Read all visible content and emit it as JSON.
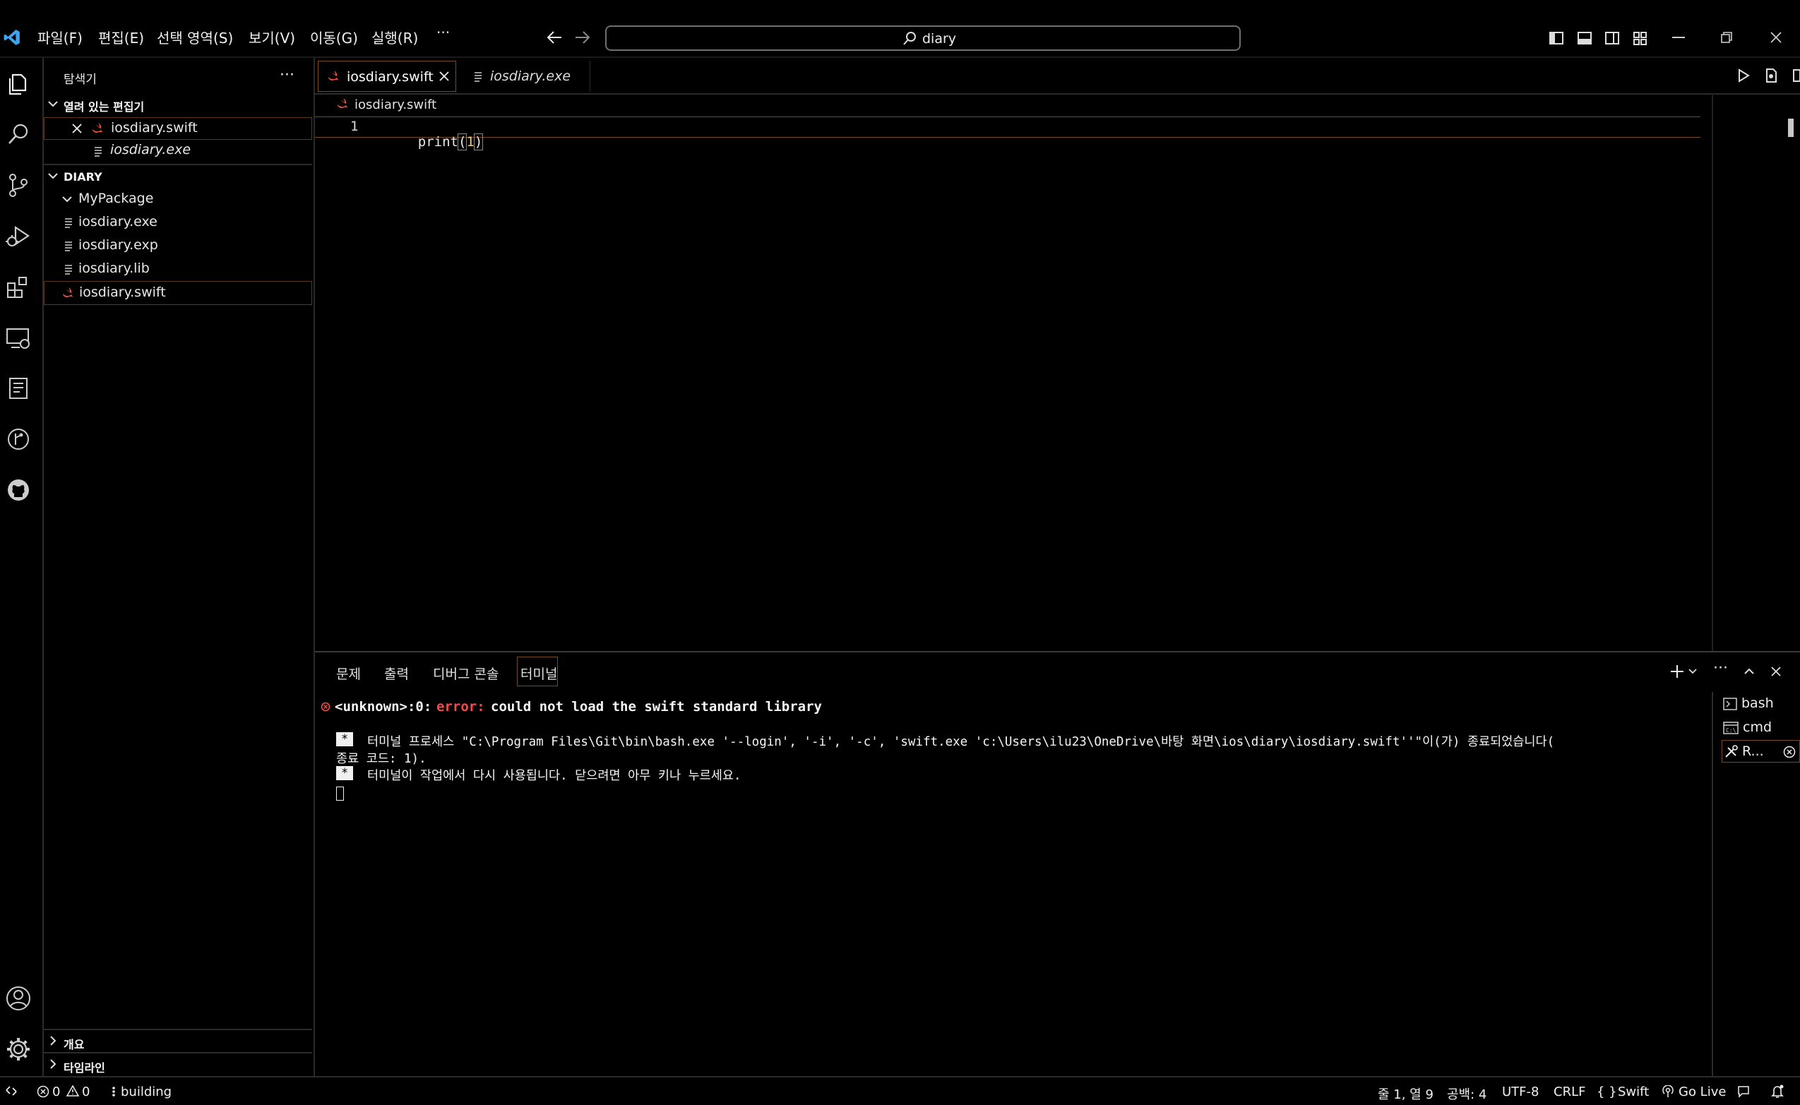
{
  "menu": [
    "파일(F)",
    "편집(E)",
    "선택 영역(S)",
    "보기(V)",
    "이동(G)",
    "실행(R)",
    "···"
  ],
  "search": {
    "text": "diary"
  },
  "sidebar": {
    "title": "탐색기",
    "more": "···",
    "open_editors": {
      "header": "열려 있는 편집기",
      "items": [
        "iosdiary.swift",
        "iosdiary.exe"
      ]
    },
    "folder": {
      "header": "DIARY",
      "items": [
        "MyPackage",
        "iosdiary.exe",
        "iosdiary.exp",
        "iosdiary.lib",
        "iosdiary.swift"
      ]
    },
    "outline": "개요",
    "timeline": "타임라인"
  },
  "tabs": [
    {
      "label": "iosdiary.swift",
      "active": true
    },
    {
      "label": "iosdiary.exe",
      "active": false
    }
  ],
  "breadcrumb": "iosdiary.swift",
  "editor": {
    "line_number": "1",
    "code_fn": "print",
    "code_open": "(",
    "code_arg": "1",
    "code_close": ")"
  },
  "panel": {
    "tabs": [
      "문제",
      "출력",
      "디버그 콘솔",
      "터미널"
    ],
    "terminal": {
      "error_source": "<unknown>:0:",
      "error_word": "error:",
      "error_msg": "could not load the swift standard library",
      "star": "*",
      "line1": "터미널 프로세스 \"C:\\Program Files\\Git\\bin\\bash.exe '--login', '-i', '-c', 'swift.exe 'c:\\Users\\ilu23\\OneDrive\\바탕 화면\\ios\\diary\\iosdiary.swift''\"이(가) 종료되었습니다(",
      "line1b": "종료 코드: 1).",
      "line2": "터미널이 작업에서 다시 사용됩니다. 닫으려면 아무 키나 누르세요."
    },
    "terminals": [
      "bash",
      "cmd",
      "R..."
    ]
  },
  "status": {
    "errors": "0",
    "warnings": "0",
    "task": "building",
    "position": "줄 1, 열 9",
    "spaces": "공백: 4",
    "encoding": "UTF-8",
    "eol": "CRLF",
    "lang_braces": "{ }",
    "language": "Swift",
    "golive": "Go Live"
  },
  "colors": {
    "swift": "#f05138",
    "error": "#f14c4c",
    "accent": "#c07a30"
  }
}
